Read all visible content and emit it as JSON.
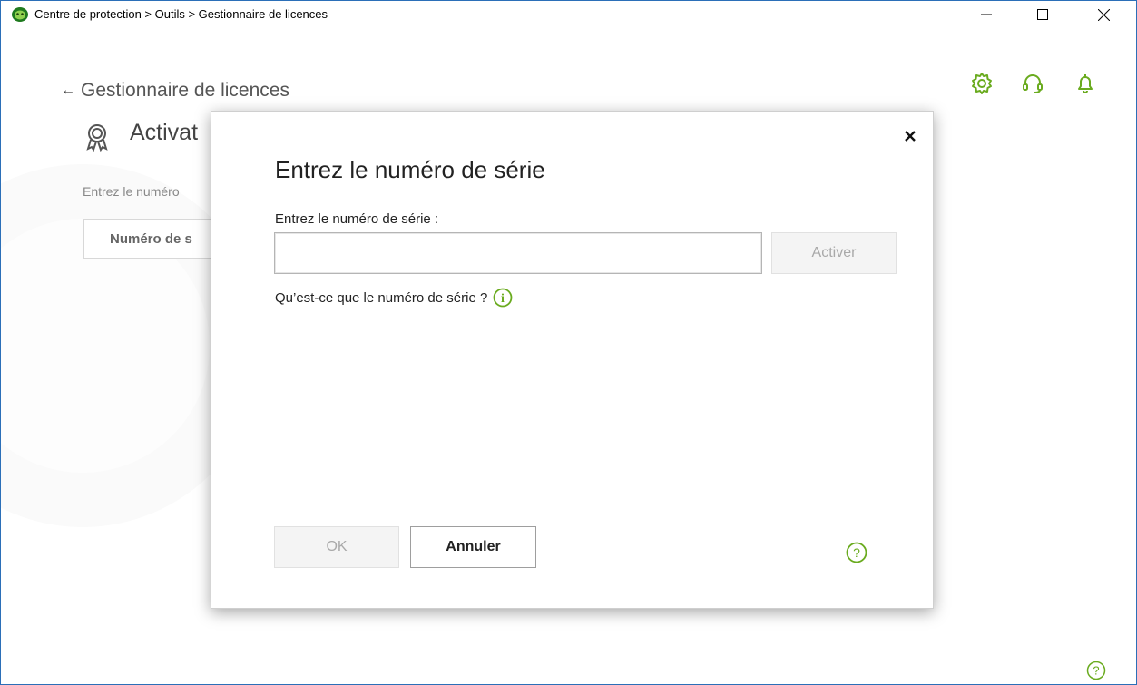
{
  "window": {
    "title": "Centre de protection > Outils > Gestionnaire de licences",
    "controls": {
      "minimize": "minimize-icon",
      "maximize": "maximize-icon",
      "close": "close-icon"
    }
  },
  "header": {
    "back_label": "Gestionnaire de licences",
    "icons": [
      "gear-icon",
      "headset-icon",
      "bell-icon"
    ]
  },
  "background_page": {
    "section_title": "Activat",
    "description": "Entrez le numéro",
    "button_label": "Numéro de s"
  },
  "dialog": {
    "title": "Entrez le numéro de série",
    "field_label": "Entrez le numéro de série :",
    "serial_value": "",
    "serial_placeholder": "",
    "activate_label": "Activer",
    "help_link": "Qu’est-ce que le numéro de série ?",
    "ok_label": "OK",
    "cancel_label": "Annuler"
  },
  "colors": {
    "accent_green": "#6aab1f",
    "window_border": "#2b6fb8",
    "disabled_text": "#a9a9a9"
  }
}
